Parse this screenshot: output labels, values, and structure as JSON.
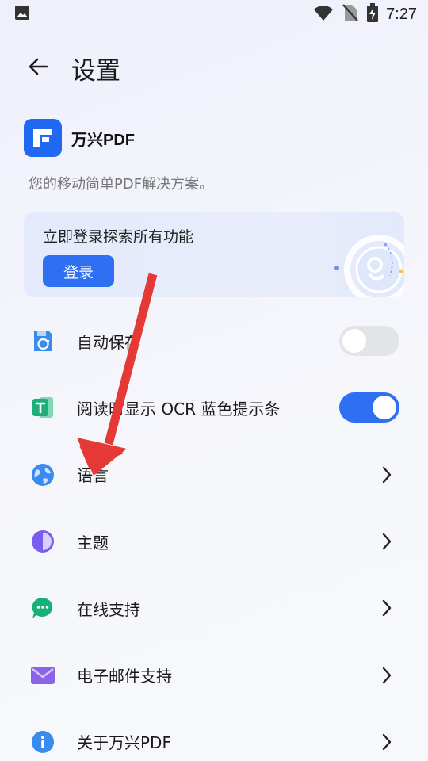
{
  "status_bar": {
    "time": "7:27",
    "icons": [
      "image-notification-icon",
      "wifi-icon",
      "no-sim-icon",
      "battery-charging-icon"
    ]
  },
  "header": {
    "back_icon": "arrow-left-icon",
    "title": "设置"
  },
  "brand": {
    "name": "万兴PDF",
    "tagline": "您的移动简单PDF解决方案。"
  },
  "login_card": {
    "text": "立即登录探索所有功能",
    "button_label": "登录"
  },
  "settings": [
    {
      "label": "自动保存",
      "icon": "auto-save-icon",
      "control": "toggle",
      "state": "off"
    },
    {
      "label": "阅读时显示 OCR 蓝色提示条",
      "icon": "ocr-text-icon",
      "control": "toggle",
      "state": "on"
    },
    {
      "label": "语言",
      "icon": "globe-icon",
      "control": "chevron"
    },
    {
      "label": "主题",
      "icon": "theme-icon",
      "control": "chevron"
    },
    {
      "label": "在线支持",
      "icon": "chat-icon",
      "control": "chevron"
    },
    {
      "label": "电子邮件支持",
      "icon": "mail-icon",
      "control": "chevron"
    },
    {
      "label": "关于万兴PDF",
      "icon": "info-icon",
      "control": "chevron"
    }
  ],
  "annotation": {
    "icon": "red-arrow-annotation",
    "color": "#e53935"
  },
  "colors": {
    "accent": "#2f6ff2",
    "brand": "#2069f5"
  }
}
